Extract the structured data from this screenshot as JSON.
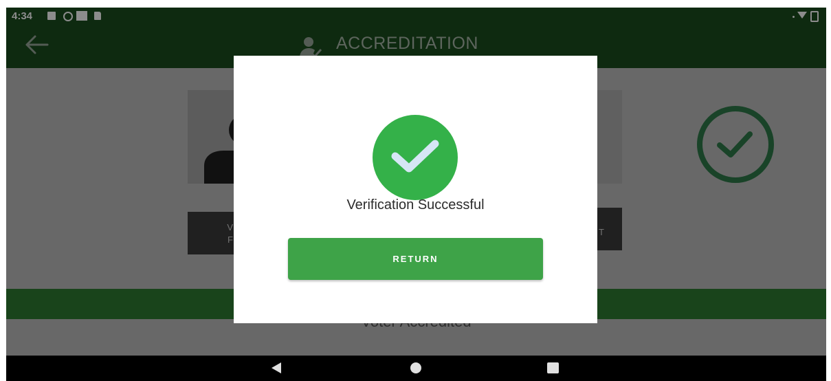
{
  "status_bar": {
    "time": "4:34",
    "left_icons": [
      "gallery-icon",
      "alert-icon",
      "square-icon",
      "sim-icon"
    ],
    "right_icons": [
      "wifi-icon",
      "battery-icon"
    ]
  },
  "app_bar": {
    "title": "ACCREDITATION",
    "back_icon": "arrow-left-icon",
    "title_icon": "person-check-icon",
    "color": "#1b4d1e"
  },
  "background": {
    "verify_button_label": "V\nF",
    "right_button_label": "T",
    "accredit_status": "Voter Accredited",
    "accent_color": "#2e7d32"
  },
  "dialog": {
    "message": "Verification Successful",
    "return_label": "RETURN",
    "icon": "success-check-icon",
    "icon_color": "#34b149",
    "button_color": "#3ea348"
  },
  "nav_bar": {
    "icons": [
      "nav-back-icon",
      "nav-home-icon",
      "nav-recents-icon"
    ]
  }
}
